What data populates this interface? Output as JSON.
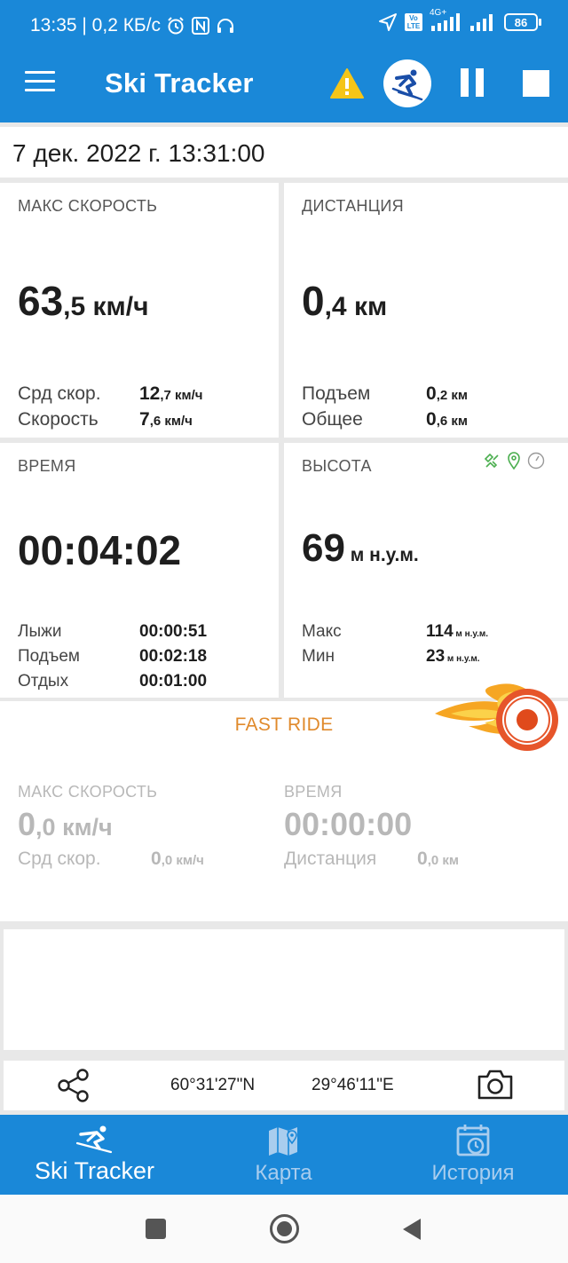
{
  "status_bar": {
    "time_speed": "13:35 | 0,2 КБ/с",
    "volte": "Vo LTE",
    "network": "4G+",
    "battery": "86"
  },
  "app_bar": {
    "title": "Ski Tracker",
    "icons": [
      "menu-icon",
      "warning-icon",
      "skier-icon",
      "pause-icon",
      "stop-icon"
    ]
  },
  "date": "7 дек. 2022 г. 13:31:00",
  "max_speed_card": {
    "label": "МАКС СКОРОСТЬ",
    "value_int": "63",
    "value_dec": ",5",
    "unit": " км/ч",
    "rows": [
      {
        "label": "Срд скор.",
        "int": "12",
        "rest": ",7 км/ч"
      },
      {
        "label": "Скорость",
        "int": "7",
        "rest": ",6 км/ч"
      }
    ]
  },
  "distance_card": {
    "label": "ДИСТАНЦИЯ",
    "value_int": "0",
    "value_dec": ",4",
    "unit": " км",
    "rows": [
      {
        "label": "Подъем",
        "int": "0",
        "rest": ",2 км"
      },
      {
        "label": "Общее",
        "int": "0",
        "rest": ",6 км"
      }
    ]
  },
  "time_card": {
    "label": "ВРЕМЯ",
    "value": "00:04:02",
    "rows": [
      {
        "label": "Лыжи",
        "value": "00:00:51"
      },
      {
        "label": "Подъем",
        "value": "00:02:18"
      },
      {
        "label": "Отдых",
        "value": "00:01:00"
      }
    ]
  },
  "altitude_card": {
    "label": "ВЫСОТА",
    "value": "69",
    "unit": " м н.у.м.",
    "rows": [
      {
        "label": "Макс",
        "value": "114",
        "unit": " м н.у.м."
      },
      {
        "label": "Мин",
        "value": "23",
        "unit": " м н.у.м."
      }
    ],
    "source_icons": [
      "satellite-icon",
      "location-pin-icon",
      "barometer-icon"
    ]
  },
  "fast_ride": {
    "title": "FAST RIDE",
    "max_speed_label": "МАКС СКОРОСТЬ",
    "max_speed_int": "0",
    "max_speed_dec": ",0",
    "max_speed_unit": " км/ч",
    "avg_label": "Срд скор.",
    "avg_int": "0",
    "avg_rest": ",0 км/ч",
    "time_label": "ВРЕМЯ",
    "time_value": "00:00:00",
    "dist_label": "Дистанция",
    "dist_int": "0",
    "dist_rest": ",0 км"
  },
  "coords": {
    "lat": "60°31'27\"N",
    "lon": "29°46'11\"E"
  },
  "bottom_nav": {
    "items": [
      {
        "label": "Ski Tracker",
        "active": true
      },
      {
        "label": "Карта",
        "active": false
      },
      {
        "label": "История",
        "active": false
      }
    ]
  },
  "colors": {
    "primary": "#1a88d8",
    "accent": "#e08a2c",
    "record": "#e04a1c",
    "inactive_nav": "#a9cdee",
    "muted": "#b8b8b8"
  }
}
